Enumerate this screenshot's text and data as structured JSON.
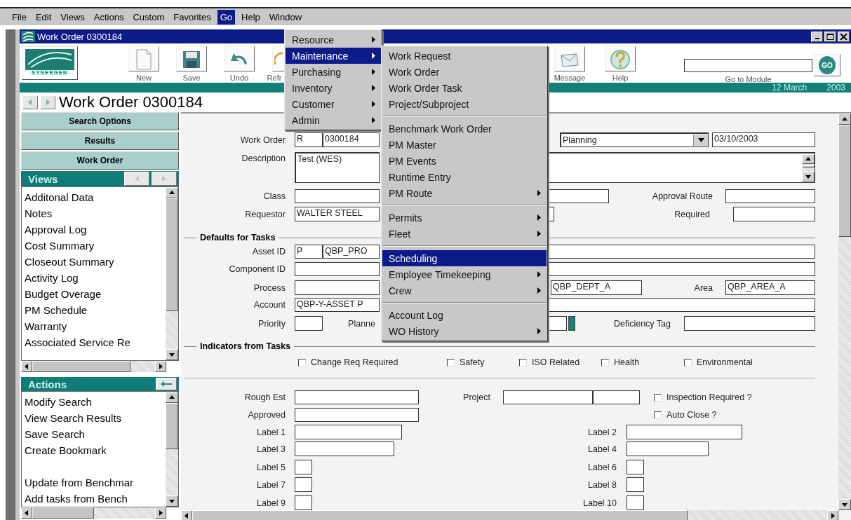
{
  "menubar": [
    {
      "label": "File",
      "selected": false
    },
    {
      "label": "Edit",
      "selected": false
    },
    {
      "label": "Views",
      "selected": false
    },
    {
      "label": "Actions",
      "selected": false
    },
    {
      "label": "Custom",
      "selected": false
    },
    {
      "label": "Favorites",
      "selected": false
    },
    {
      "label": "Go",
      "selected": true
    },
    {
      "label": "Help",
      "selected": false
    },
    {
      "label": "Window",
      "selected": false
    }
  ],
  "window": {
    "title": "Work Order 0300184"
  },
  "toolbar": {
    "logo": "SYNERGEN",
    "buttons": [
      {
        "kind": "new",
        "label": "New"
      },
      {
        "kind": "save",
        "label": "Save"
      },
      {
        "kind": "undo",
        "label": "Undo"
      },
      {
        "kind": "refresh",
        "label": "Refr"
      },
      {
        "kind": "message",
        "label": "Message"
      },
      {
        "kind": "help",
        "label": "Help"
      }
    ],
    "go_to_module": {
      "label": "Go to Module",
      "button": "GO"
    }
  },
  "date_bar": {
    "date": "12 March",
    "year": "2003"
  },
  "record_header": {
    "title": "Work Order 0300184"
  },
  "sidebar": {
    "nav_buttons": [
      "Search Options",
      "Results",
      "Work Order"
    ],
    "views": {
      "title": "Views",
      "arrows": [
        {
          "kind": "previous",
          "disabled": true
        },
        {
          "kind": "next",
          "disabled": true
        }
      ],
      "items": [
        "Additonal Data",
        "Notes",
        "Approval Log",
        "Cost Summary",
        "Closeout Summary",
        "Activity Log",
        "Budget Overage",
        "PM Schedule",
        "Warranty",
        "Associated Service Re"
      ]
    },
    "actions": {
      "title": "Actions",
      "items": [
        {
          "label": "Modify Search",
          "gap_before": false
        },
        {
          "label": "View Search Results",
          "gap_before": false
        },
        {
          "label": "Save Search",
          "gap_before": false
        },
        {
          "label": "Create Bookmark",
          "gap_before": false
        },
        {
          "label": "Update from Benchmar",
          "gap_before": true
        },
        {
          "label": "Add tasks from Bench",
          "gap_before": false
        }
      ]
    }
  },
  "form": {
    "rows": [
      {
        "kind": "fields",
        "items": [
          {
            "kind": "label",
            "text": "Work Order"
          },
          {
            "kind": "field",
            "value": "R"
          },
          {
            "kind": "field",
            "value": "0300184"
          },
          {
            "kind": "select",
            "value": "Planning"
          },
          {
            "kind": "field",
            "value": "03/10/2003"
          }
        ]
      },
      {
        "kind": "fields",
        "items": [
          {
            "kind": "label",
            "text": "Description"
          },
          {
            "kind": "textarea",
            "value": "Test (WES)"
          },
          {
            "kind": "scroll_area"
          }
        ]
      },
      {
        "kind": "fields",
        "items": [
          {
            "kind": "label",
            "text": "Class"
          },
          {
            "kind": "field"
          },
          {
            "kind": "field"
          },
          {
            "kind": "label",
            "text": "Approval Route"
          },
          {
            "kind": "field"
          }
        ]
      },
      {
        "kind": "fields",
        "items": [
          {
            "kind": "label",
            "text": "Requestor"
          },
          {
            "kind": "field",
            "value": "WALTER STEEL"
          },
          {
            "kind": "field"
          },
          {
            "kind": "label",
            "text": "Required"
          },
          {
            "kind": "field"
          }
        ]
      },
      {
        "kind": "section",
        "title": "Defaults for Tasks"
      },
      {
        "kind": "fields",
        "items": [
          {
            "kind": "label",
            "text": "Asset ID"
          },
          {
            "kind": "field",
            "value": "P"
          },
          {
            "kind": "field",
            "value": "QBP_PRO"
          },
          {
            "kind": "field"
          }
        ]
      },
      {
        "kind": "fields",
        "items": [
          {
            "kind": "label",
            "text": "Component ID"
          },
          {
            "kind": "field"
          },
          {
            "kind": "field"
          }
        ]
      },
      {
        "kind": "fields",
        "items": [
          {
            "kind": "label",
            "text": "Process"
          },
          {
            "kind": "field"
          },
          {
            "kind": "field",
            "value": "QBP_DEPT_A"
          },
          {
            "kind": "label",
            "text": "Area"
          },
          {
            "kind": "field",
            "value": "QBP_AREA_A"
          }
        ]
      },
      {
        "kind": "fields",
        "items": [
          {
            "kind": "label",
            "text": "Account"
          },
          {
            "kind": "field",
            "value": "QBP-Y-ASSET P"
          },
          {
            "kind": "field"
          }
        ]
      },
      {
        "kind": "fields",
        "items": [
          {
            "kind": "label",
            "text": "Priority"
          },
          {
            "kind": "field"
          },
          {
            "kind": "label",
            "text": "Planne"
          },
          {
            "kind": "field"
          },
          {
            "kind": "marker"
          },
          {
            "kind": "label",
            "text": "Deficiency Tag"
          },
          {
            "kind": "field"
          }
        ]
      },
      {
        "kind": "section",
        "title": "Indicators from Tasks"
      },
      {
        "kind": "checkboxes",
        "items": [
          {
            "kind": "checkbox",
            "label": "Change Req Required",
            "checked": false
          },
          {
            "kind": "checkbox",
            "label": "Safety",
            "checked": false
          },
          {
            "kind": "checkbox",
            "label": "ISO Related",
            "checked": false
          },
          {
            "kind": "checkbox",
            "label": "Health",
            "checked": false
          },
          {
            "kind": "checkbox",
            "label": "Environmental",
            "checked": false
          }
        ]
      },
      {
        "kind": "fields",
        "items": [
          {
            "kind": "label",
            "text": "Rough Est"
          },
          {
            "kind": "field"
          },
          {
            "kind": "label",
            "text": "Project"
          },
          {
            "kind": "field"
          },
          {
            "kind": "field"
          },
          {
            "kind": "checkbox",
            "label": "Inspection Required ?",
            "checked": false
          }
        ]
      },
      {
        "kind": "fields",
        "items": [
          {
            "kind": "label",
            "text": "Approved"
          },
          {
            "kind": "field"
          },
          {
            "kind": "checkbox",
            "label": "Auto Close ?",
            "checked": false
          }
        ]
      },
      {
        "kind": "fields",
        "items": [
          {
            "kind": "label",
            "text": "Label 1"
          },
          {
            "kind": "field"
          },
          {
            "kind": "label",
            "text": "Label 2"
          },
          {
            "kind": "field"
          }
        ]
      },
      {
        "kind": "fields",
        "items": [
          {
            "kind": "label",
            "text": "Label 3"
          },
          {
            "kind": "field"
          },
          {
            "kind": "label",
            "text": "Label 4"
          },
          {
            "kind": "field"
          }
        ]
      },
      {
        "kind": "fields",
        "items": [
          {
            "kind": "label",
            "text": "Label 5"
          },
          {
            "kind": "field"
          },
          {
            "kind": "label",
            "text": "Label 6"
          },
          {
            "kind": "field"
          }
        ]
      },
      {
        "kind": "fields",
        "items": [
          {
            "kind": "label",
            "text": "Label 7"
          },
          {
            "kind": "field"
          },
          {
            "kind": "label",
            "text": "Label 8"
          },
          {
            "kind": "field"
          }
        ]
      },
      {
        "kind": "fields",
        "items": [
          {
            "kind": "label",
            "text": "Label 9"
          },
          {
            "kind": "field"
          },
          {
            "kind": "label",
            "text": "Label 10"
          },
          {
            "kind": "field"
          }
        ]
      }
    ]
  },
  "go_menu": {
    "items": [
      {
        "label": "Resource",
        "has_submenu": true,
        "selected": false
      },
      {
        "label": "Maintenance",
        "has_submenu": true,
        "selected": true
      },
      {
        "label": "Purchasing",
        "has_submenu": true,
        "selected": false
      },
      {
        "label": "Inventory",
        "has_submenu": true,
        "selected": false
      },
      {
        "label": "Customer",
        "has_submenu": true,
        "selected": false
      },
      {
        "label": "Admin",
        "has_submenu": true,
        "selected": false
      }
    ]
  },
  "maintenance_submenu": {
    "groups": [
      {
        "items": [
          {
            "label": "Work Request",
            "has_submenu": false,
            "selected": false
          },
          {
            "label": "Work Order",
            "has_submenu": false,
            "selected": false
          },
          {
            "label": "Work Order Task",
            "has_submenu": false,
            "selected": false
          },
          {
            "label": "Project/Subproject",
            "has_submenu": false,
            "selected": false
          }
        ]
      },
      {
        "items": [
          {
            "label": "Benchmark Work Order",
            "has_submenu": false,
            "selected": false
          },
          {
            "label": "PM Master",
            "has_submenu": false,
            "selected": false
          },
          {
            "label": "PM Events",
            "has_submenu": false,
            "selected": false
          },
          {
            "label": "Runtime Entry",
            "has_submenu": false,
            "selected": false
          },
          {
            "label": "PM Route",
            "has_submenu": true,
            "selected": false
          }
        ]
      },
      {
        "items": [
          {
            "label": "Permits",
            "has_submenu": true,
            "selected": false
          },
          {
            "label": "Fleet",
            "has_submenu": true,
            "selected": false
          }
        ]
      },
      {
        "items": [
          {
            "label": "Scheduling",
            "has_submenu": false,
            "selected": true
          },
          {
            "label": "Employee Timekeeping",
            "has_submenu": true,
            "selected": false
          },
          {
            "label": "Crew",
            "has_submenu": true,
            "selected": false
          }
        ]
      },
      {
        "items": [
          {
            "label": "Account Log",
            "has_submenu": false,
            "selected": false
          },
          {
            "label": "WO History",
            "has_submenu": true,
            "selected": false
          }
        ]
      }
    ]
  }
}
